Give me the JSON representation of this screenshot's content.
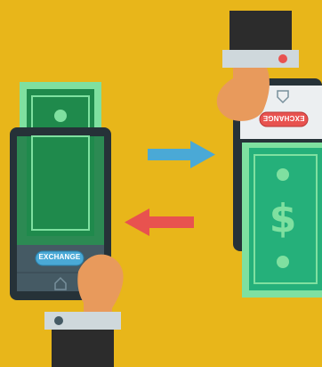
{
  "colors": {
    "background": "#e8b61a",
    "phone_frame": "#263238",
    "bill_green": "#1f8a4c",
    "bill_light": "#7fe0a0",
    "bill_teal": "#25b07a",
    "arrow_blue": "#4aa9d6",
    "arrow_red": "#e8524f",
    "button_blue": "#4aa9d6",
    "button_red": "#e8524f",
    "skin": "#e89a5c",
    "sleeve_dark": "#2c2c2c",
    "cuff_gray": "#cfd8dc"
  },
  "left_phone": {
    "button_label": "EXCHANGE",
    "bill_icon": "rupee-icon",
    "home_icon": "home-icon"
  },
  "right_phone": {
    "button_label": "EXCHANGE",
    "bill_icon": "dollar-icon",
    "home_icon": "home-icon"
  },
  "arrows": {
    "top_direction": "right",
    "bottom_direction": "left"
  }
}
